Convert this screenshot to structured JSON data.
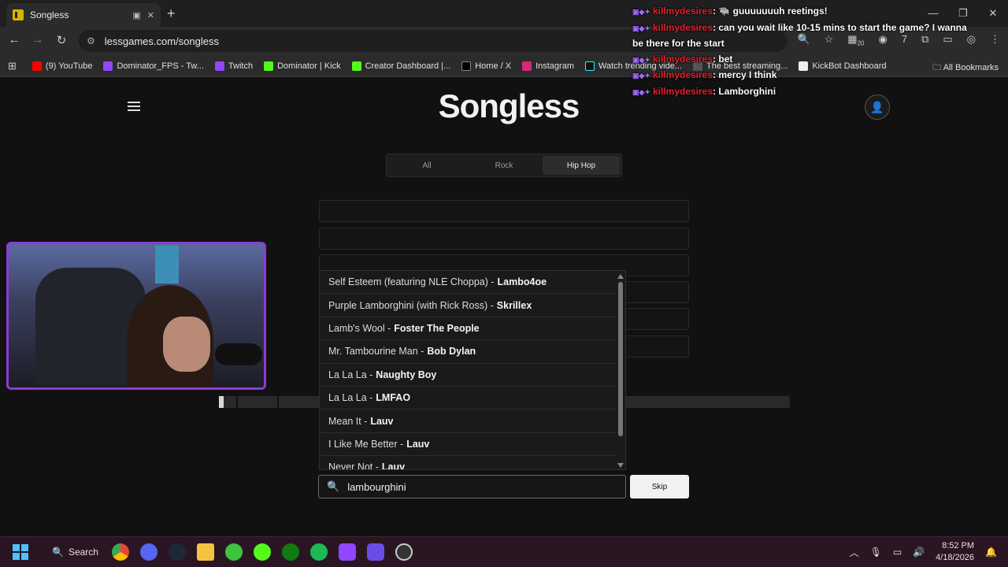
{
  "browser": {
    "tab_title": "Songless",
    "url": "lessgames.com/songless",
    "bookmarks": [
      "(9) YouTube",
      "Dominator_FPS - Tw...",
      "Twitch",
      "Dominator | Kick",
      "Creator Dashboard |...",
      "Home / X",
      "Instagram",
      "Watch trending vide...",
      "The best streaming...",
      "KickBot Dashboard"
    ],
    "all_bookmarks": "All Bookmarks",
    "extension_badge": "20"
  },
  "page": {
    "logo": "Songless",
    "genre_tabs": [
      "All",
      "Rock",
      "Hip Hop"
    ],
    "active_genre": "Hip Hop",
    "skip_label": "Skip",
    "search_value": "lambourghini"
  },
  "suggestions": [
    {
      "title": "Self Esteem (featuring NLE Choppa) -",
      "artist": "Lambo4oe"
    },
    {
      "title": "Purple Lamborghini (with Rick Ross) -",
      "artist": "Skrillex"
    },
    {
      "title": "Lamb's Wool -",
      "artist": "Foster The People"
    },
    {
      "title": "Mr. Tambourine Man -",
      "artist": "Bob Dylan"
    },
    {
      "title": "La La La -",
      "artist": "Naughty Boy"
    },
    {
      "title": "La La La -",
      "artist": "LMFAO"
    },
    {
      "title": "Mean It -",
      "artist": "Lauv"
    },
    {
      "title": "I Like Me Better -",
      "artist": "Lauv"
    },
    {
      "title": "Never Not -",
      "artist": "Lauv"
    }
  ],
  "chat": [
    {
      "user": "killmydesires",
      "message": ": 🐃 guuuuuuuh reetings!"
    },
    {
      "user": "killmydesires",
      "message": ": can you wait like 10-15 mins to start the game? I wanna be there for the start"
    },
    {
      "user": "killmydesires",
      "message": ": bet"
    },
    {
      "user": "killmydesires",
      "message": ": mercy I think"
    },
    {
      "user": "killmydesires",
      "message": ": Lamborghini"
    }
  ],
  "taskbar": {
    "search_label": "Search",
    "time": "8:52 PM",
    "date": "4/18/2026"
  },
  "colors": {
    "accent_purple": "#8b3bd6",
    "chat_username": "#e0202a",
    "page_bg": "#111111"
  }
}
